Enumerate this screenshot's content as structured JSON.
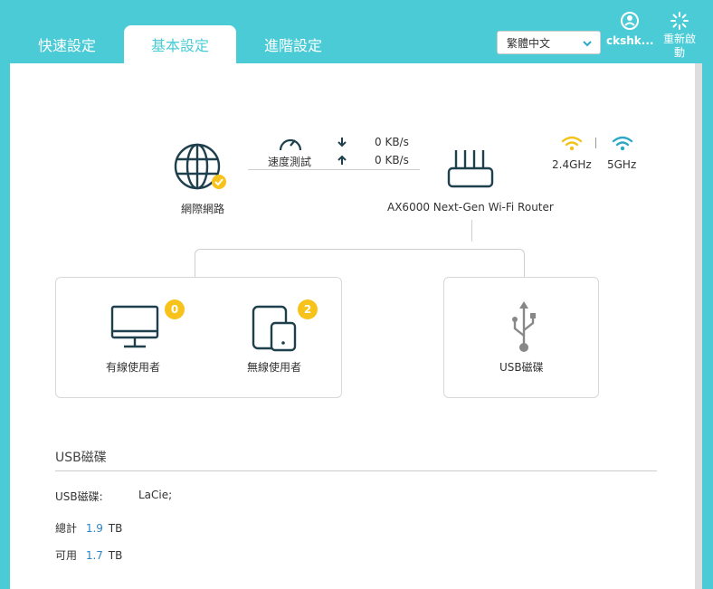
{
  "tabs": [
    {
      "label": "快速設定"
    },
    {
      "label": "基本設定"
    },
    {
      "label": "進階設定"
    }
  ],
  "language": {
    "selected": "繁體中文"
  },
  "account": {
    "name": "ckshk..."
  },
  "reboot": {
    "label": "重新啟動"
  },
  "internet": {
    "label": "網際網路"
  },
  "speed_test": {
    "label": "速度測試",
    "download": "0 KB/s",
    "upload": "0 KB/s"
  },
  "router": {
    "name": "AX6000 Next-Gen Wi-Fi Router",
    "band_24": "2.4GHz",
    "band_5": "5GHz"
  },
  "clients": {
    "wired": {
      "label": "有線使用者",
      "count": "0"
    },
    "wireless": {
      "label": "無線使用者",
      "count": "2"
    }
  },
  "usb": {
    "label": "USB磁碟"
  },
  "usb_section": {
    "title": "USB磁碟",
    "disk_label": "USB磁碟:",
    "disk_value": "LaCie;",
    "total_label": "總計",
    "total_value": "1.9",
    "total_unit": "TB",
    "free_label": "可用",
    "free_value": "1.7",
    "free_unit": "TB"
  },
  "colors": {
    "accent": "#4acbd6",
    "badge": "#f7c21a",
    "wifi_24": "#f2c318",
    "wifi_5": "#2aa9c9",
    "value_blue": "#2a86c8"
  }
}
